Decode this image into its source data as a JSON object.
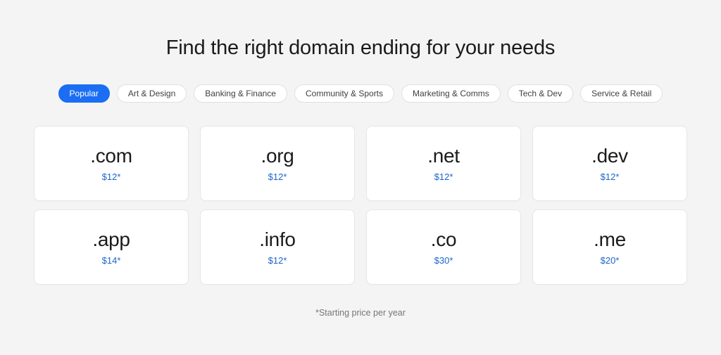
{
  "heading": "Find the right domain ending for your needs",
  "colors": {
    "page_background": "#f4f4f4",
    "chip_active_background": "#1b6ef3",
    "chip_active_text": "#ffffff",
    "card_background": "#ffffff",
    "price_text": "#1b66c9",
    "footnote_text": "#767676"
  },
  "chips": [
    {
      "label": "Popular",
      "active": true
    },
    {
      "label": "Art & Design",
      "active": false
    },
    {
      "label": "Banking & Finance",
      "active": false
    },
    {
      "label": "Community & Sports",
      "active": false
    },
    {
      "label": "Marketing & Comms",
      "active": false
    },
    {
      "label": "Tech & Dev",
      "active": false
    },
    {
      "label": "Service & Retail",
      "active": false
    }
  ],
  "cards": [
    {
      "tld": ".com",
      "price": "$12*"
    },
    {
      "tld": ".org",
      "price": "$12*"
    },
    {
      "tld": ".net",
      "price": "$12*"
    },
    {
      "tld": ".dev",
      "price": "$12*"
    },
    {
      "tld": ".app",
      "price": "$14*"
    },
    {
      "tld": ".info",
      "price": "$12*"
    },
    {
      "tld": ".co",
      "price": "$30*"
    },
    {
      "tld": ".me",
      "price": "$20*"
    }
  ],
  "footnote": "*Starting price per year"
}
